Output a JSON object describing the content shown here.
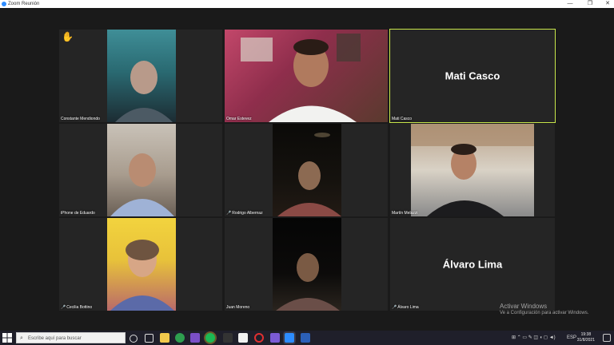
{
  "window": {
    "title": "Zoom Reunión",
    "minimize": "—",
    "maximize": "❐",
    "close": "✕"
  },
  "participants": [
    {
      "name": "Constante Mendiondo",
      "muted": false,
      "hand_raised": true,
      "video": true
    },
    {
      "name": "Omar Estevez",
      "muted": false,
      "video": true
    },
    {
      "name": "Mati Casco",
      "display_name": "Mati Casco",
      "muted": false,
      "video": false,
      "active_speaker": true
    },
    {
      "name": "iPhone de Eduardo",
      "muted": false,
      "video": true
    },
    {
      "name": "Rodrigo Albernaz",
      "muted": true,
      "video": true
    },
    {
      "name": "Martín Melazzi",
      "muted": false,
      "video": true
    },
    {
      "name": "Cecilia Bottino",
      "muted": true,
      "video": true
    },
    {
      "name": "Juan Moreno",
      "muted": false,
      "video": true
    },
    {
      "name": "Álvaro Lima",
      "display_name": "Álvaro Lima",
      "muted": true,
      "video": false
    }
  ],
  "watermark": {
    "line1": "Activar Windows",
    "line2": "Ve a Configuración para activar Windows."
  },
  "taskbar": {
    "search_placeholder": "Escribe aquí para buscar",
    "tray_lang": "ESP",
    "clock_time": "19:38",
    "clock_date": "31/8/2021"
  },
  "colors": {
    "active_speaker_border": "#c9e84b",
    "muted_icon": "#e03535",
    "zoom_blue": "#2d8cff"
  }
}
